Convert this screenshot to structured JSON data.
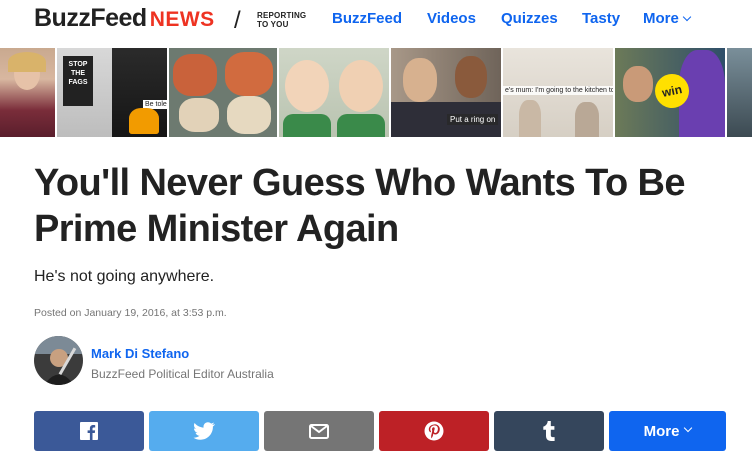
{
  "header": {
    "logo_main": "BuzzFeed",
    "logo_news": "NEWS",
    "slash": "/",
    "tagline_line1": "REPORTING",
    "tagline_line2": "TO YOU",
    "nav": [
      {
        "label": "BuzzFeed"
      },
      {
        "label": "Videos"
      },
      {
        "label": "Quizzes"
      },
      {
        "label": "Tasty"
      },
      {
        "label": "More"
      }
    ]
  },
  "strip": {
    "captions": {
      "sign": "STOP THE FAGS",
      "sign_small": "Be tolerant",
      "ring": "Put a ring on",
      "mum": "e's mum: I'm going to the kitchen to c",
      "win": "win"
    }
  },
  "article": {
    "title": "You'll Never Guess Who Wants To Be Prime Minister Again",
    "dek": "He's not going anywhere.",
    "posted": "Posted on January 19, 2016, at 3:53 p.m.",
    "author": "Mark Di Stefano",
    "role": "BuzzFeed Political Editor Australia"
  },
  "share": {
    "buttons": [
      {
        "icon": "facebook-icon",
        "color": "#3b5998"
      },
      {
        "icon": "twitter-icon",
        "color": "#55acee"
      },
      {
        "icon": "mail-icon",
        "color": "#757575"
      },
      {
        "icon": "pinterest-icon",
        "color": "#bd2126"
      },
      {
        "icon": "tumblr-icon",
        "color": "#35465c"
      }
    ],
    "more_label": "More",
    "more_color": "#0f65ef"
  },
  "colors": {
    "accent": "#0f65ef",
    "news_red": "#e32",
    "text": "#222222",
    "muted": "#757575"
  }
}
